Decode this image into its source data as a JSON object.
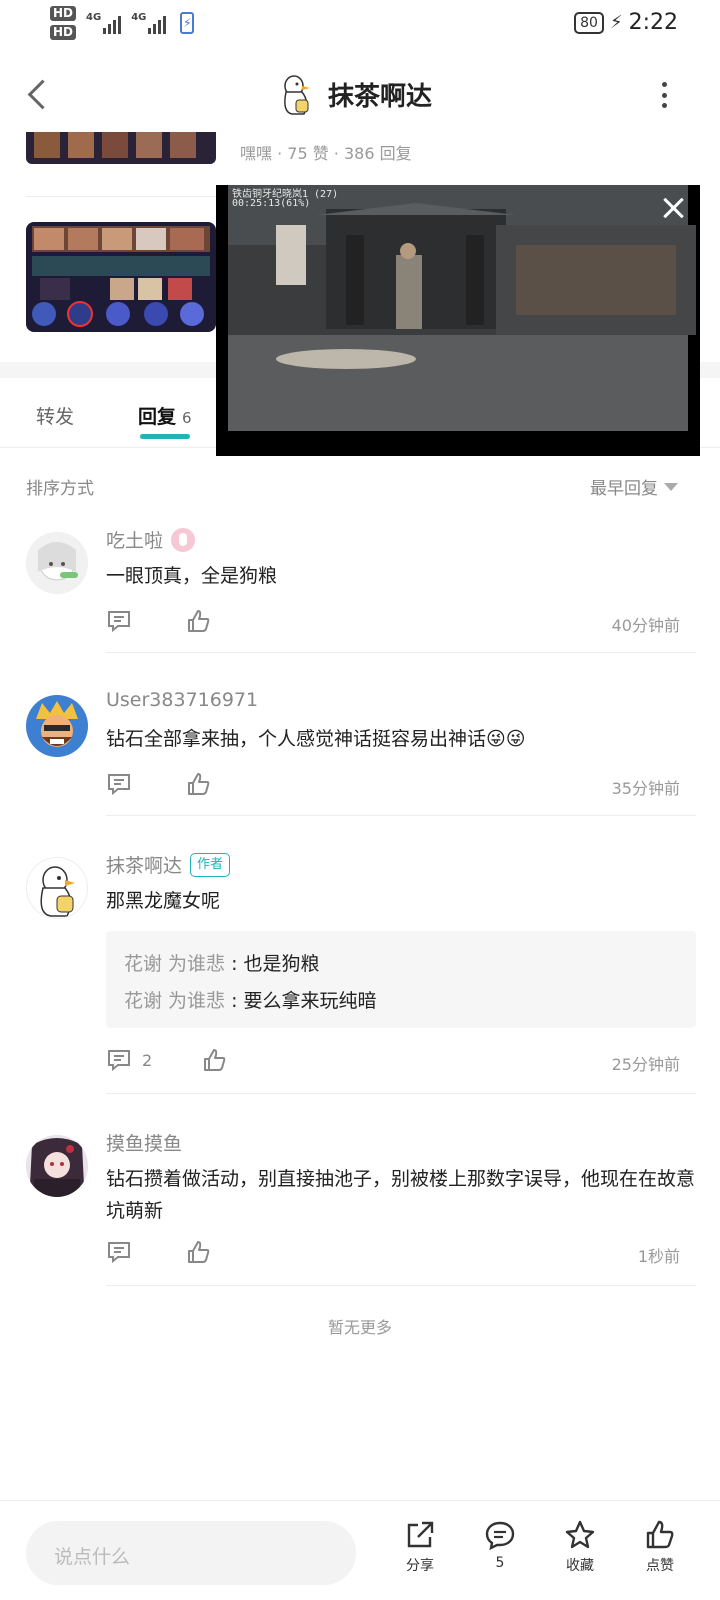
{
  "status_bar": {
    "hd1": "HD",
    "hd2": "HD",
    "net1": "4G",
    "net2": "4G",
    "battery": "80",
    "time": "2:22"
  },
  "header": {
    "title": "抹茶啊达"
  },
  "post_meta": {
    "line": "嘿嘿 · 75 赞 · 386 回复"
  },
  "video": {
    "overlay_line1": "铁齿铜牙纪晓岚1 (27)",
    "overlay_line2": "00:25:13(61%)"
  },
  "tabs": {
    "repost": "转发",
    "reply": "回复",
    "reply_count": "6"
  },
  "sort": {
    "label": "排序方式",
    "selected": "最早回复"
  },
  "comments": [
    {
      "name": "吃土啦",
      "text": "一眼顶真，全是狗粮",
      "time": "40分钟前"
    },
    {
      "name": "User383716971",
      "text": "钻石全部拿来抽，个人感觉神话挺容易出神话😜😜",
      "time": "35分钟前"
    },
    {
      "name": "抹茶啊达",
      "badge": "作者",
      "text": "那黑龙魔女呢",
      "replies": [
        {
          "who": "花谢 为谁悲",
          "sep": " : ",
          "text": "也是狗粮"
        },
        {
          "who": "花谢 为谁悲",
          "sep": " : ",
          "text": "要么拿来玩纯暗"
        }
      ],
      "reply_count": "2",
      "time": "25分钟前"
    },
    {
      "name": "摸鱼摸鱼",
      "text": "钻石攒着做活动，别直接抽池子，别被楼上那数字误导，他现在在故意坑萌新",
      "time": "1秒前"
    }
  ],
  "no_more": "暂无更多",
  "bottom_bar": {
    "input_placeholder": "说点什么",
    "share": "分享",
    "comments": "5",
    "favorite": "收藏",
    "like": "点赞"
  },
  "colors": {
    "accent": "#20b3b8",
    "text_primary": "#222222",
    "text_secondary": "#888888"
  }
}
